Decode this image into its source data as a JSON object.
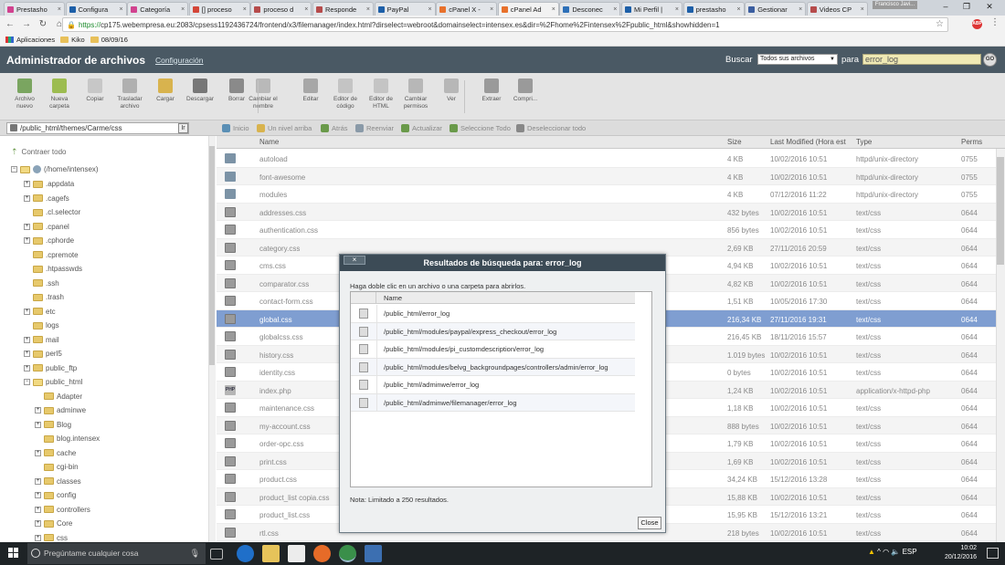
{
  "browser": {
    "tabs": [
      {
        "label": "Prestasho",
        "favicon_color": "#d1428f",
        "active": false
      },
      {
        "label": "Configura",
        "favicon_color": "#1d5fa8",
        "active": false
      },
      {
        "label": "Categoría",
        "favicon_color": "#d1428f",
        "active": false
      },
      {
        "label": "[] proceso",
        "favicon_color": "#d44638",
        "active": false
      },
      {
        "label": "proceso d",
        "favicon_color": "#b64b4b",
        "active": false
      },
      {
        "label": "Responde",
        "favicon_color": "#b64b4b",
        "active": false
      },
      {
        "label": "PayPal",
        "favicon_color": "#1d5fa8",
        "active": false
      },
      {
        "label": "cPanel X -",
        "favicon_color": "#e8712c",
        "active": false
      },
      {
        "label": "cPanel Ad",
        "favicon_color": "#e8712c",
        "active": true
      },
      {
        "label": "Desconec",
        "favicon_color": "#2d6fb8",
        "active": false
      },
      {
        "label": "Mi Perfil |",
        "favicon_color": "#1d5fa8",
        "active": false
      },
      {
        "label": "prestasho",
        "favicon_color": "#1d5fa8",
        "active": false
      },
      {
        "label": "Gestionar",
        "favicon_color": "#3b5ea0",
        "active": false
      },
      {
        "label": "Videos CP",
        "favicon_color": "#b64b4b",
        "active": false
      }
    ],
    "user_chip": "Francisco Javi...",
    "url_https": "https://",
    "url_rest": "cp175.webempresa.eu:2083/cpsess1192436724/frontend/x3/filemanager/index.html?dirselect=webroot&domainselect=intensex.es&dir=%2Fhome%2Fintensex%2Fpublic_html&showhidden=1",
    "abp": "ABP",
    "bookmarks": [
      {
        "label": "Aplicaciones",
        "icon": "apps-icon"
      },
      {
        "label": "Kiko",
        "icon": "folder-icon"
      },
      {
        "label": "08/09/16",
        "icon": "folder-icon"
      }
    ]
  },
  "header": {
    "title": "Administrador de archivos",
    "config_link": "Configuración",
    "search_label": "Buscar",
    "search_scope": "Todos sus archivos",
    "para_label": "para",
    "search_value": "error_log",
    "go_label": "GO"
  },
  "toolbar": {
    "buttons": [
      {
        "label": "Archivo nuevo",
        "icon": "new-file-icon",
        "color": "#7aa560"
      },
      {
        "label": "Nueva carpeta",
        "icon": "new-folder-icon",
        "color": "#9cbc50"
      },
      {
        "label": "Copiar",
        "icon": "copy-icon",
        "color": "#c7c7c7"
      },
      {
        "label": "Trasladar archivo",
        "icon": "move-icon",
        "color": "#b0b0b0"
      },
      {
        "label": "Cargar",
        "icon": "upload-icon",
        "color": "#d8b34e"
      },
      {
        "label": "Descargar",
        "icon": "download-icon",
        "color": "#777777"
      },
      {
        "label": "Borrar",
        "icon": "delete-icon",
        "color": "#8a8a8a"
      },
      {
        "label": "Cambiar el nombre",
        "icon": "rename-icon",
        "color": "#b9b9b9"
      },
      {
        "label": "Editar",
        "icon": "edit-icon",
        "color": "#a7a7a7"
      },
      {
        "label": "Editor de código",
        "icon": "code-editor-icon",
        "color": "#c4c4c4"
      },
      {
        "label": "Editor de HTML",
        "icon": "html-editor-icon",
        "color": "#c4c4c4"
      },
      {
        "label": "Cambiar permisos",
        "icon": "permissions-icon",
        "color": "#b7b7b7"
      },
      {
        "label": "Ver",
        "icon": "view-icon",
        "color": "#b7b7b7"
      },
      {
        "label": "Extraer",
        "icon": "extract-icon",
        "color": "#9a9a9a"
      },
      {
        "label": "Compri...",
        "icon": "compress-icon",
        "color": "#9a9a9a"
      }
    ]
  },
  "pathbar": {
    "path": "/public_html/themes/Carme/css",
    "go": "Ir",
    "nav": [
      {
        "label": "Inicio",
        "icon": "home-icon"
      },
      {
        "label": "Un nivel arriba",
        "icon": "up-level-icon"
      },
      {
        "label": "Atrás",
        "icon": "back-icon"
      },
      {
        "label": "Reenviar",
        "icon": "forward-icon"
      },
      {
        "label": "Actualizar",
        "icon": "refresh-icon"
      },
      {
        "label": "Seleccione Todo",
        "icon": "select-all-icon"
      },
      {
        "label": "Deseleccionar todo",
        "icon": "deselect-all-icon"
      }
    ]
  },
  "tree": {
    "collapse_label": "Contraer todo",
    "root": "(/home/intensex)",
    "nodes": [
      {
        "label": ".appdata",
        "level": 1,
        "expander": "+"
      },
      {
        "label": ".cagefs",
        "level": 1,
        "expander": "+"
      },
      {
        "label": ".cl.selector",
        "level": 1,
        "expander": ""
      },
      {
        "label": ".cpanel",
        "level": 1,
        "expander": "+"
      },
      {
        "label": ".cphorde",
        "level": 1,
        "expander": "+"
      },
      {
        "label": ".cpremote",
        "level": 1,
        "expander": ""
      },
      {
        "label": ".htpasswds",
        "level": 1,
        "expander": ""
      },
      {
        "label": ".ssh",
        "level": 1,
        "expander": ""
      },
      {
        "label": ".trash",
        "level": 1,
        "expander": ""
      },
      {
        "label": "etc",
        "level": 1,
        "expander": "+"
      },
      {
        "label": "logs",
        "level": 1,
        "expander": ""
      },
      {
        "label": "mail",
        "level": 1,
        "expander": "+"
      },
      {
        "label": "perl5",
        "level": 1,
        "expander": "+"
      },
      {
        "label": "public_ftp",
        "level": 1,
        "expander": "+"
      },
      {
        "label": "public_html",
        "level": 1,
        "expander": "-"
      },
      {
        "label": "Adapter",
        "level": 2,
        "expander": ""
      },
      {
        "label": "adminwe",
        "level": 2,
        "expander": "+"
      },
      {
        "label": "Blog",
        "level": 2,
        "expander": "+"
      },
      {
        "label": "blog.intensex",
        "level": 2,
        "expander": ""
      },
      {
        "label": "cache",
        "level": 2,
        "expander": "+"
      },
      {
        "label": "cgi-bin",
        "level": 2,
        "expander": ""
      },
      {
        "label": "classes",
        "level": 2,
        "expander": "+"
      },
      {
        "label": "config",
        "level": 2,
        "expander": "+"
      },
      {
        "label": "controllers",
        "level": 2,
        "expander": "+"
      },
      {
        "label": "Core",
        "level": 2,
        "expander": "+"
      },
      {
        "label": "css",
        "level": 2,
        "expander": "+"
      }
    ]
  },
  "table": {
    "headers": [
      "Name",
      "Size",
      "Last Modified (Hora est",
      "Type",
      "Perms"
    ],
    "rows": [
      {
        "name": "autoload",
        "size": "4 KB",
        "modified": "10/02/2016 10:51",
        "type": "httpd/unix-directory",
        "perms": "0755",
        "kind": "dir"
      },
      {
        "name": "font-awesome",
        "size": "4 KB",
        "modified": "10/02/2016 10:51",
        "type": "httpd/unix-directory",
        "perms": "0755",
        "kind": "dir"
      },
      {
        "name": "modules",
        "size": "4 KB",
        "modified": "07/12/2016 11:22",
        "type": "httpd/unix-directory",
        "perms": "0755",
        "kind": "dir"
      },
      {
        "name": "addresses.css",
        "size": "432 bytes",
        "modified": "10/02/2016 10:51",
        "type": "text/css",
        "perms": "0644",
        "kind": "css"
      },
      {
        "name": "authentication.css",
        "size": "856 bytes",
        "modified": "10/02/2016 10:51",
        "type": "text/css",
        "perms": "0644",
        "kind": "css"
      },
      {
        "name": "category.css",
        "size": "2,69 KB",
        "modified": "27/11/2016 20:59",
        "type": "text/css",
        "perms": "0644",
        "kind": "css"
      },
      {
        "name": "cms.css",
        "size": "4,94 KB",
        "modified": "10/02/2016 10:51",
        "type": "text/css",
        "perms": "0644",
        "kind": "css"
      },
      {
        "name": "comparator.css",
        "size": "4,82 KB",
        "modified": "10/02/2016 10:51",
        "type": "text/css",
        "perms": "0644",
        "kind": "css"
      },
      {
        "name": "contact-form.css",
        "size": "1,51 KB",
        "modified": "10/05/2016 17:30",
        "type": "text/css",
        "perms": "0644",
        "kind": "css"
      },
      {
        "name": "global.css",
        "size": "216,34 KB",
        "modified": "27/11/2016 19:31",
        "type": "text/css",
        "perms": "0644",
        "kind": "css",
        "selected": true
      },
      {
        "name": "globalcss.css",
        "size": "216,45 KB",
        "modified": "18/11/2016 15:57",
        "type": "text/css",
        "perms": "0644",
        "kind": "css"
      },
      {
        "name": "history.css",
        "size": "1.019 bytes",
        "modified": "10/02/2016 10:51",
        "type": "text/css",
        "perms": "0644",
        "kind": "css"
      },
      {
        "name": "identity.css",
        "size": "0 bytes",
        "modified": "10/02/2016 10:51",
        "type": "text/css",
        "perms": "0644",
        "kind": "css"
      },
      {
        "name": "index.php",
        "size": "1,24 KB",
        "modified": "10/02/2016 10:51",
        "type": "application/x-httpd-php",
        "perms": "0644",
        "kind": "php"
      },
      {
        "name": "maintenance.css",
        "size": "1,18 KB",
        "modified": "10/02/2016 10:51",
        "type": "text/css",
        "perms": "0644",
        "kind": "css"
      },
      {
        "name": "my-account.css",
        "size": "888 bytes",
        "modified": "10/02/2016 10:51",
        "type": "text/css",
        "perms": "0644",
        "kind": "css"
      },
      {
        "name": "order-opc.css",
        "size": "1,79 KB",
        "modified": "10/02/2016 10:51",
        "type": "text/css",
        "perms": "0644",
        "kind": "css"
      },
      {
        "name": "print.css",
        "size": "1,69 KB",
        "modified": "10/02/2016 10:51",
        "type": "text/css",
        "perms": "0644",
        "kind": "css"
      },
      {
        "name": "product.css",
        "size": "34,24 KB",
        "modified": "15/12/2016 13:28",
        "type": "text/css",
        "perms": "0644",
        "kind": "css"
      },
      {
        "name": "product_list copia.css",
        "size": "15,88 KB",
        "modified": "10/02/2016 10:51",
        "type": "text/css",
        "perms": "0644",
        "kind": "css"
      },
      {
        "name": "product_list.css",
        "size": "15,95 KB",
        "modified": "15/12/2016 13:21",
        "type": "text/css",
        "perms": "0644",
        "kind": "css"
      },
      {
        "name": "rtl.css",
        "size": "218 bytes",
        "modified": "10/02/2016 10:51",
        "type": "text/css",
        "perms": "0644",
        "kind": "css"
      }
    ]
  },
  "dialog": {
    "close_x": "×",
    "title": "Resultados de búsqueda para: error_log",
    "hint": "Haga doble clic en un archivo o una carpeta para abrirlos.",
    "column_name": "Name",
    "results": [
      "/public_html/error_log",
      "/public_html/modules/paypal/express_checkout/error_log",
      "/public_html/modules/pi_customdescription/error_log",
      "/public_html/modules/belvg_backgroundpages/controllers/admin/error_log",
      "/public_html/adminwe/error_log",
      "/public_html/adminwe/filemanager/error_log"
    ],
    "note": "Nota: Limitado a 250 resultados.",
    "close_label": "Close"
  },
  "taskbar": {
    "search_placeholder": "Pregúntame cualquier cosa",
    "tray_lang": "ESP",
    "time": "10:02",
    "date": "20/12/2016"
  }
}
